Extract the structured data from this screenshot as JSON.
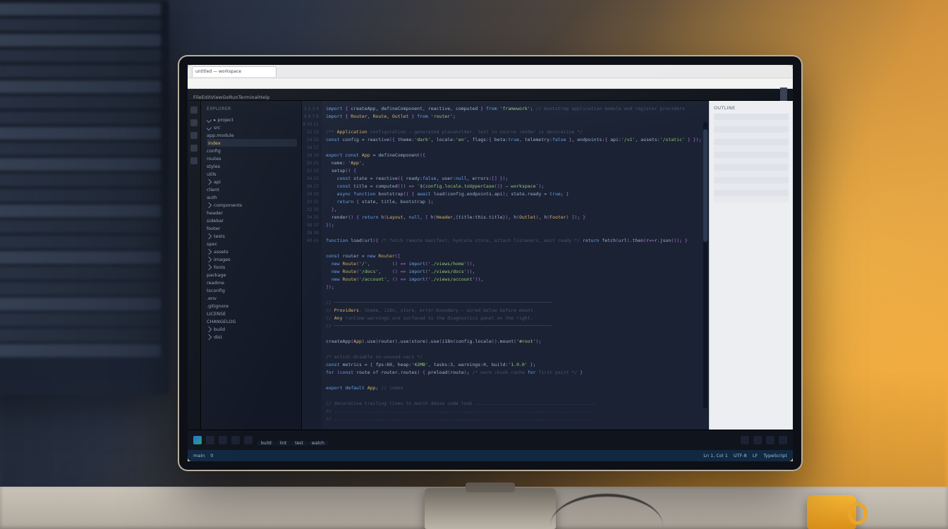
{
  "scene": {
    "description": "3D-rendered illustration of a modern desktop monitor on a desk in a warmly lit, blurred office. The monitor shows a dark-themed code editor / IDE with a file explorer on the left, a code pane in the center, a light side panel on the right, and a bottom status bar. Text on screen is stylized and not legible as real words.",
    "props": [
      "secondary monitor (left, blurred)",
      "yellow mug (right)",
      "desk cable"
    ]
  },
  "browser": {
    "tab_title": "untitled — workspace",
    "address": ""
  },
  "ide": {
    "menu": [
      "File",
      "Edit",
      "View",
      "Go",
      "Run",
      "Terminal",
      "Help"
    ],
    "toolbar_icons": [
      "layout-icon",
      "split-icon",
      "preview-icon",
      "settings-icon",
      "more-icon"
    ],
    "explorer_header": "Explorer",
    "explorer_items": [
      {
        "label": "▸ project",
        "kind": "folder",
        "open": true
      },
      {
        "label": "  src",
        "kind": "folder",
        "open": true,
        "sel": false
      },
      {
        "label": "    app.module",
        "kind": "file"
      },
      {
        "label": "    index",
        "kind": "file",
        "sel": true
      },
      {
        "label": "    config",
        "kind": "file"
      },
      {
        "label": "    routes",
        "kind": "file"
      },
      {
        "label": "    styles",
        "kind": "file"
      },
      {
        "label": "    utils",
        "kind": "file"
      },
      {
        "label": "    api",
        "kind": "folder"
      },
      {
        "label": "      client",
        "kind": "file"
      },
      {
        "label": "      auth",
        "kind": "file"
      },
      {
        "label": "    components",
        "kind": "folder"
      },
      {
        "label": "      header",
        "kind": "file"
      },
      {
        "label": "      sidebar",
        "kind": "file"
      },
      {
        "label": "      footer",
        "kind": "file"
      },
      {
        "label": "  tests",
        "kind": "folder"
      },
      {
        "label": "    spec",
        "kind": "file"
      },
      {
        "label": "  assets",
        "kind": "folder"
      },
      {
        "label": "    images",
        "kind": "folder"
      },
      {
        "label": "    fonts",
        "kind": "folder"
      },
      {
        "label": "  package",
        "kind": "file"
      },
      {
        "label": "  readme",
        "kind": "file"
      },
      {
        "label": "  tsconfig",
        "kind": "file"
      },
      {
        "label": "  .env",
        "kind": "file"
      },
      {
        "label": "  .gitignore",
        "kind": "file"
      },
      {
        "label": "  LICENSE",
        "kind": "file"
      },
      {
        "label": "  CHANGELOG",
        "kind": "file"
      },
      {
        "label": "  build",
        "kind": "folder"
      },
      {
        "label": "  dist",
        "kind": "folder"
      }
    ],
    "code_lines": [
      "import { createApp, defineComponent, reactive, computed } from 'framework'; // bootstrap application module and register providers",
      "import { Router, Route, Outlet } from 'router';",
      "",
      "/** Application configuration — generated placeholder, text in source render is decorative */",
      "const config = reactive({ theme:'dark', locale:'en', flags:{ beta:true, telemetry:false }, endpoints:{ api:'/v1', assets:'/static' } });",
      "",
      "export const App = defineComponent({",
      "  name: 'App',",
      "  setup() {",
      "    const state = reactive({ ready:false, user:null, errors:[] });",
      "    const title = computed(() => `${config.locale.toUpperCase()} — workspace`);",
      "    async function bootstrap() { await load(config.endpoints.api); state.ready = true; }",
      "    return { state, title, bootstrap };",
      "  },",
      "  render() { return h(Layout, null, [ h(Header,{title:this.title}), h(Outlet), h(Footer) ]); }",
      "});",
      "",
      "function load(url){ /* fetch remote manifest, hydrate store, attach listeners, emit ready */ return fetch(url).then(r=>r.json()); }",
      "",
      "const router = new Router([",
      "  new Route('/',        () => import('./views/home')),",
      "  new Route('/docs',    () => import('./views/docs')),",
      "  new Route('/account', () => import('./views/account')),",
      "]);",
      "",
      "// ───────────────────────────────────────────────────────────────────────────────",
      "// Providers: theme, i18n, store, error-boundary — wired below before mount.",
      "// Any runtime warnings are surfaced to the diagnostics panel on the right.",
      "// ───────────────────────────────────────────────────────────────────────────────",
      "",
      "createApp(App).use(router).use(store).use(i18n(config.locale)).mount('#root');",
      "",
      "/* eslint-disable no-unused-vars */",
      "const metrics = { fps:60, heap:'42MB', tasks:3, warnings:0, build:'1.0.0' };",
      "for (const route of router.routes) { preload(route); /* warm chunk cache for first paint */ }",
      "",
      "export default App; // index",
      "",
      "// decorative trailing lines to match dense code look ............................................",
      "// ..............................................................................................",
      "// .............................................................................................."
    ],
    "right_panel_header": "Outline",
    "right_panel_rows": 14,
    "taskbar_pills": [
      "build",
      "lint",
      "test",
      "watch"
    ],
    "status": {
      "branch": "main",
      "problems": "0",
      "ln_col": "Ln 1, Col 1",
      "encoding": "UTF-8",
      "eol": "LF",
      "lang": "TypeScript"
    }
  }
}
